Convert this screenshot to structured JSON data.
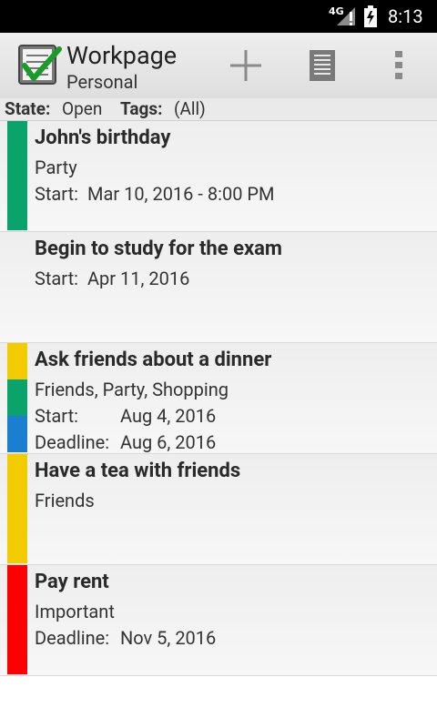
{
  "status_bar": {
    "network": "4G",
    "time": "8:13"
  },
  "action_bar": {
    "title": "Workpage",
    "subtitle": "Personal",
    "icons": [
      "checklist-app-icon",
      "add-icon",
      "list-view-icon",
      "overflow-menu-icon"
    ]
  },
  "filter": {
    "state_label": "State:",
    "state_value": "Open",
    "tags_label": "Tags:",
    "tags_value": "(All)"
  },
  "tasks": [
    {
      "title": "John's birthday",
      "tags": "Party",
      "colors": [
        "#0aa36b"
      ],
      "start_label": "Start:",
      "start": "Mar 10, 2016 - 8:00 PM"
    },
    {
      "title": "Begin to study for the exam",
      "colors": [],
      "start_label": "Start:",
      "start": "Apr 11, 2016"
    },
    {
      "title": "Ask friends about a dinner",
      "tags": "Friends, Party, Shopping",
      "colors": [
        "#f2cc00",
        "#0aa36b",
        "#1a7fd1"
      ],
      "start_label": "Start:",
      "start": "Aug 4, 2016",
      "deadline_label": "Deadline:",
      "deadline": "Aug 6, 2016"
    },
    {
      "title": "Have a tea with friends",
      "tags": "Friends",
      "colors": [
        "#f2cc00"
      ]
    },
    {
      "title": "Pay rent",
      "tags": "Important",
      "colors": [
        "#ff0000"
      ],
      "deadline_label": "Deadline:",
      "deadline": "Nov 5, 2016"
    }
  ]
}
